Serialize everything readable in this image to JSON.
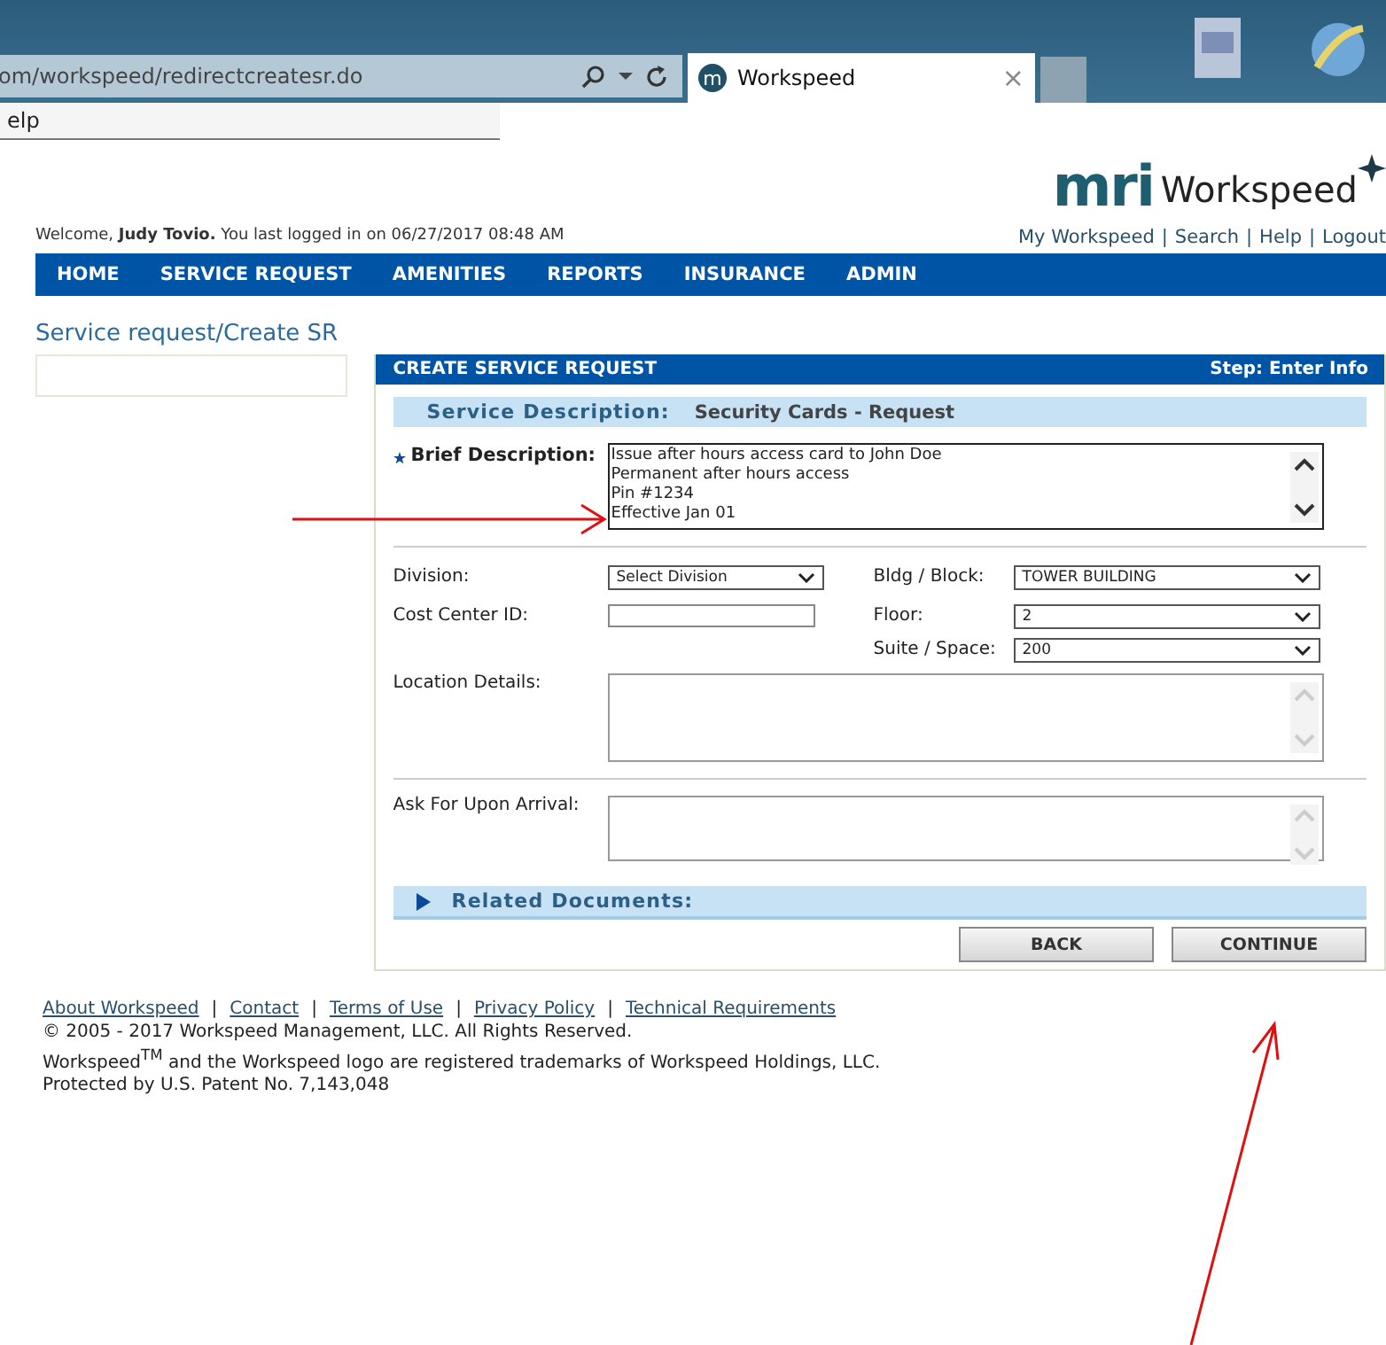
{
  "browser": {
    "address": "om/workspeed/redirectcreatesr.do",
    "tab_icon": "m",
    "tab_title": "Workspeed",
    "close": "×",
    "menu": "elp"
  },
  "header": {
    "logo_mark": "mri",
    "logo_text": "Workspeed",
    "welcome": "Welcome, **Judy Tovio.** You last logged in on 06/27/2017 08:48 AM",
    "separator": "|",
    "links": [
      "My Workspeed",
      "Search",
      "Help",
      "Logout"
    ]
  },
  "nav": [
    "HOME",
    "SERVICE REQUEST",
    "AMENITIES",
    "REPORTS",
    "INSURANCE",
    "ADMIN"
  ],
  "breadcrumb": "Service request/Create SR",
  "panel": {
    "title": "CREATE SERVICE REQUEST",
    "step": "Step: Enter Info",
    "service_label": "Service Description:",
    "service_value": "Security Cards - Request",
    "brief_label": "Brief Description:",
    "brief_lines": [
      "Issue after hours access card to John Doe",
      "Permanent after hours access",
      "Pin #1234",
      "Effective Jan 01"
    ],
    "left_fields": [
      {
        "label": "Division:",
        "kind": "select",
        "value": "Select Division"
      },
      {
        "label": "Cost Center ID:",
        "kind": "input"
      }
    ],
    "right_fields": [
      {
        "label": "Bldg / Block:",
        "kind": "select",
        "value": "TOWER BUILDING"
      },
      {
        "label": "Floor:",
        "kind": "select",
        "value": "2"
      },
      {
        "label": "Suite / Space:",
        "kind": "select",
        "value": "200"
      }
    ],
    "location_label": "Location Details:",
    "ask_label": "Ask For Upon Arrival:",
    "related": "Related Documents:",
    "buttons": [
      "BACK",
      "CONTINUE"
    ]
  },
  "footer": {
    "separator": "|",
    "links": [
      "About Workspeed",
      "Contact",
      "Terms of Use",
      "Privacy Policy",
      "Technical Requirements"
    ],
    "lines": [
      "© 2005 - 2017 Workspeed Management, LLC. All Rights Reserved.",
      "Workspeed$^{TM}$ and the Workspeed logo are registered trademarks of Workspeed Holdings, LLC.",
      "Protected by U.S. Patent No. 7,143,048"
    ]
  }
}
